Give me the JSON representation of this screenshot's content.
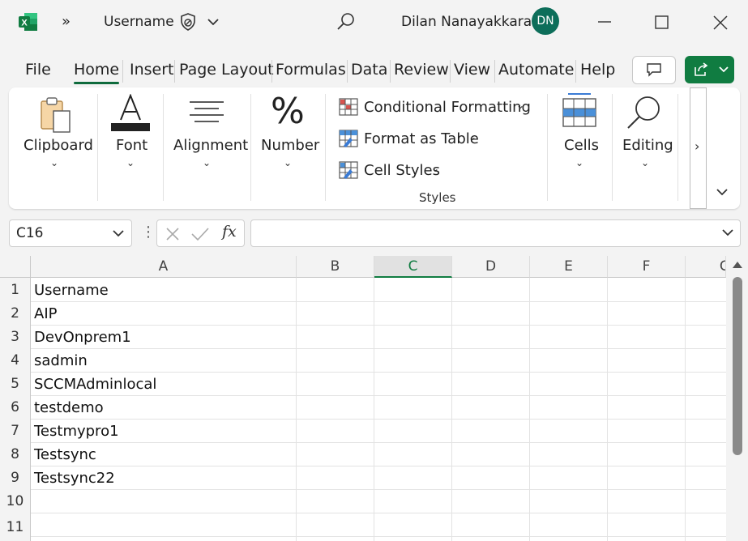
{
  "title_bar": {
    "more_label": "»",
    "file_name": "Username",
    "user_name": "Dilan Nanayakkara",
    "user_initials": "DN",
    "icons": [
      "excel-logo-icon",
      "sensitivity-icon",
      "chevron-down-icon",
      "search-icon",
      "minimize-icon",
      "maximize-icon",
      "close-icon"
    ]
  },
  "menu": {
    "tabs": [
      "File",
      "Home",
      "Insert",
      "Page Layout",
      "Formulas",
      "Data",
      "Review",
      "View",
      "Automate",
      "Help"
    ],
    "active_tab": "Home"
  },
  "ribbon": {
    "clipboard": "Clipboard",
    "font": "Font",
    "alignment": "Alignment",
    "number": "Number",
    "conditional_formatting": "Conditional Formatting",
    "format_as_table": "Format as Table",
    "cell_styles": "Cell Styles",
    "styles_group": "Styles",
    "cells": "Cells",
    "editing": "Editing",
    "more": "›"
  },
  "formula_bar": {
    "name_box": "C16",
    "fx_label": "fx",
    "formula_value": ""
  },
  "sheet": {
    "columns": [
      "A",
      "B",
      "C",
      "D",
      "E",
      "F",
      "G"
    ],
    "selected_column": "C",
    "rows": [
      {
        "num": "1",
        "a": "Username"
      },
      {
        "num": "2",
        "a": "AIP"
      },
      {
        "num": "3",
        "a": "DevOnprem1"
      },
      {
        "num": "4",
        "a": "sadmin"
      },
      {
        "num": "5",
        "a": "SCCMAdminlocal"
      },
      {
        "num": "6",
        "a": "testdemo"
      },
      {
        "num": "7",
        "a": "Testmypro1"
      },
      {
        "num": "8",
        "a": "Testsync"
      },
      {
        "num": "9",
        "a": "Testsync22"
      },
      {
        "num": "10",
        "a": ""
      },
      {
        "num": "11",
        "a": ""
      }
    ]
  },
  "colors": {
    "accent_green": "#107c41",
    "avatar_bg": "#0d6e5a"
  }
}
